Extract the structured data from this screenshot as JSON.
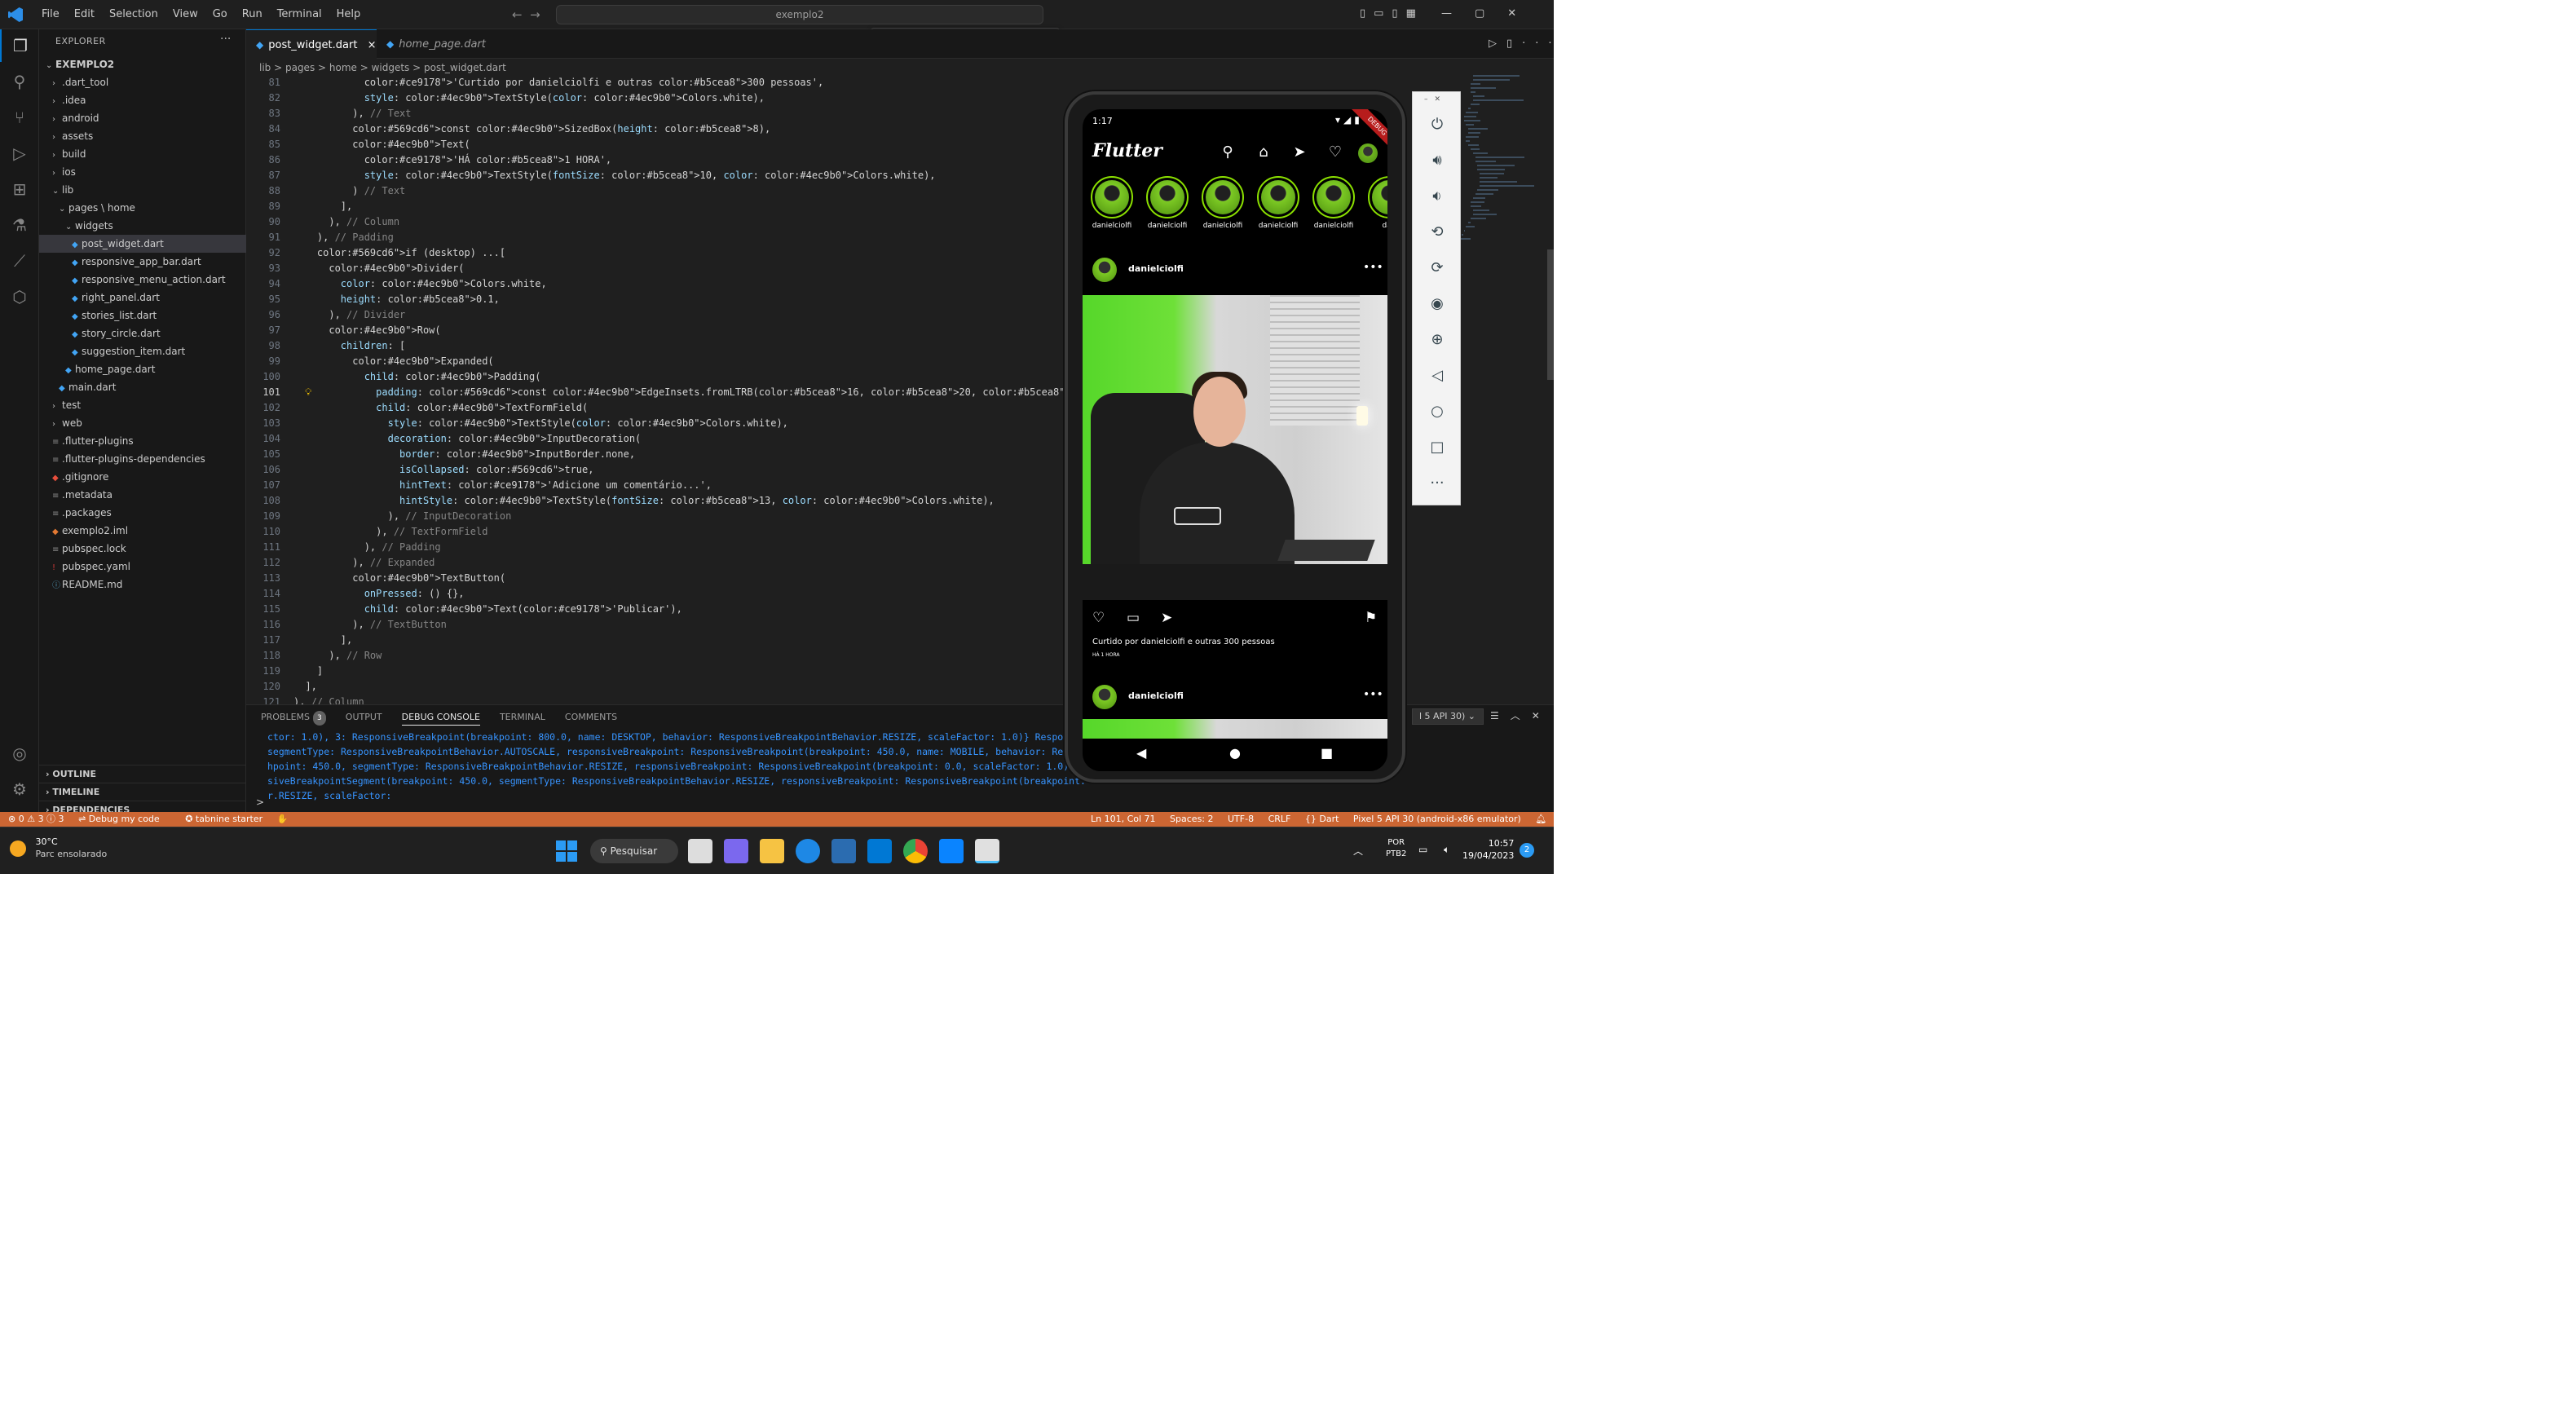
{
  "window": {
    "search": "exemplo2"
  },
  "menu": [
    "File",
    "Edit",
    "Selection",
    "View",
    "Go",
    "Run",
    "Terminal",
    "Help"
  ],
  "explorer": {
    "title": "EXPLORER",
    "root": "EXEMPLO2",
    "tree": [
      {
        "label": ".dart_tool",
        "indent": 1,
        "kind": "folder",
        "open": false
      },
      {
        "label": ".idea",
        "indent": 1,
        "kind": "folder",
        "open": false
      },
      {
        "label": "android",
        "indent": 1,
        "kind": "folder",
        "open": false
      },
      {
        "label": "assets",
        "indent": 1,
        "kind": "folder",
        "open": false
      },
      {
        "label": "build",
        "indent": 1,
        "kind": "folder",
        "open": false
      },
      {
        "label": "ios",
        "indent": 1,
        "kind": "folder",
        "open": false
      },
      {
        "label": "lib",
        "indent": 1,
        "kind": "folder",
        "open": true
      },
      {
        "label": "pages \\ home",
        "indent": 2,
        "kind": "folder",
        "open": true
      },
      {
        "label": "widgets",
        "indent": 3,
        "kind": "folder",
        "open": true
      },
      {
        "label": "post_widget.dart",
        "indent": 4,
        "kind": "dart",
        "selected": true
      },
      {
        "label": "responsive_app_bar.dart",
        "indent": 4,
        "kind": "dart"
      },
      {
        "label": "responsive_menu_action.dart",
        "indent": 4,
        "kind": "dart"
      },
      {
        "label": "right_panel.dart",
        "indent": 4,
        "kind": "dart"
      },
      {
        "label": "stories_list.dart",
        "indent": 4,
        "kind": "dart"
      },
      {
        "label": "story_circle.dart",
        "indent": 4,
        "kind": "dart"
      },
      {
        "label": "suggestion_item.dart",
        "indent": 4,
        "kind": "dart"
      },
      {
        "label": "home_page.dart",
        "indent": 3,
        "kind": "dart"
      },
      {
        "label": "main.dart",
        "indent": 2,
        "kind": "dart"
      },
      {
        "label": "test",
        "indent": 1,
        "kind": "folder",
        "open": false
      },
      {
        "label": "web",
        "indent": 1,
        "kind": "folder",
        "open": false
      },
      {
        "label": ".flutter-plugins",
        "indent": 1,
        "kind": "file"
      },
      {
        "label": ".flutter-plugins-dependencies",
        "indent": 1,
        "kind": "file"
      },
      {
        "label": ".gitignore",
        "indent": 1,
        "kind": "git"
      },
      {
        "label": ".metadata",
        "indent": 1,
        "kind": "file"
      },
      {
        "label": ".packages",
        "indent": 1,
        "kind": "file"
      },
      {
        "label": "exemplo2.iml",
        "indent": 1,
        "kind": "xml"
      },
      {
        "label": "pubspec.lock",
        "indent": 1,
        "kind": "file"
      },
      {
        "label": "pubspec.yaml",
        "indent": 1,
        "kind": "yaml"
      },
      {
        "label": "README.md",
        "indent": 1,
        "kind": "info"
      }
    ],
    "sections": [
      "OUTLINE",
      "TIMELINE",
      "DEPENDENCIES"
    ]
  },
  "tabs": [
    {
      "label": "post_widget.dart",
      "active": true,
      "close": "×"
    },
    {
      "label": "home_page.dart",
      "active": false
    }
  ],
  "breadcrumb": "lib  >  pages  >  home  >  widgets  >  post_widget.dart",
  "code": {
    "current_line": 101,
    "lines": [
      {
        "n": 81,
        "t": "            'Curtido por danielciolfi e outras 300 pessoas',"
      },
      {
        "n": 82,
        "t": "            style: TextStyle(color: Colors.white),"
      },
      {
        "n": 83,
        "t": "          ), // Text"
      },
      {
        "n": 84,
        "t": "          const SizedBox(height: 8),"
      },
      {
        "n": 85,
        "t": "          Text("
      },
      {
        "n": 86,
        "t": "            'HÁ 1 HORA',"
      },
      {
        "n": 87,
        "t": "            style: TextStyle(fontSize: 10, color: Colors.white),"
      },
      {
        "n": 88,
        "t": "          ) // Text"
      },
      {
        "n": 89,
        "t": "        ],"
      },
      {
        "n": 90,
        "t": "      ), // Column"
      },
      {
        "n": 91,
        "t": "    ), // Padding"
      },
      {
        "n": 92,
        "t": "    if (desktop) ...["
      },
      {
        "n": 93,
        "t": "      Divider("
      },
      {
        "n": 94,
        "t": "        color: Colors.white,"
      },
      {
        "n": 95,
        "t": "        height: 0.1,"
      },
      {
        "n": 96,
        "t": "      ), // Divider"
      },
      {
        "n": 97,
        "t": "      Row("
      },
      {
        "n": 98,
        "t": "        children: ["
      },
      {
        "n": 99,
        "t": "          Expanded("
      },
      {
        "n": 100,
        "t": "            child: Padding("
      },
      {
        "n": 101,
        "t": "              padding: const EdgeInsets.fromLTRB(16, 20, 0, 24),"
      },
      {
        "n": 102,
        "t": "              child: TextFormField("
      },
      {
        "n": 103,
        "t": "                style: TextStyle(color: Colors.white),"
      },
      {
        "n": 104,
        "t": "                decoration: InputDecoration("
      },
      {
        "n": 105,
        "t": "                  border: InputBorder.none,"
      },
      {
        "n": 106,
        "t": "                  isCollapsed: true,"
      },
      {
        "n": 107,
        "t": "                  hintText: 'Adicione um comentário...',"
      },
      {
        "n": 108,
        "t": "                  hintStyle: TextStyle(fontSize: 13, color: Colors.white),"
      },
      {
        "n": 109,
        "t": "                ), // InputDecoration"
      },
      {
        "n": 110,
        "t": "              ), // TextFormField"
      },
      {
        "n": 111,
        "t": "            ), // Padding"
      },
      {
        "n": 112,
        "t": "          ), // Expanded"
      },
      {
        "n": 113,
        "t": "          TextButton("
      },
      {
        "n": 114,
        "t": "            onPressed: () {},"
      },
      {
        "n": 115,
        "t": "            child: Text('Publicar'),"
      },
      {
        "n": 116,
        "t": "          ), // TextButton"
      },
      {
        "n": 117,
        "t": "        ],"
      },
      {
        "n": 118,
        "t": "      ), // Row"
      },
      {
        "n": 119,
        "t": "    ]"
      },
      {
        "n": 120,
        "t": "  ],"
      },
      {
        "n": 121,
        "t": "), // Column"
      }
    ]
  },
  "panel": {
    "tabs": [
      {
        "label": "PROBLEMS",
        "badge": "3"
      },
      {
        "label": "OUTPUT"
      },
      {
        "label": "DEBUG CONSOLE",
        "active": true
      },
      {
        "label": "TERMINAL"
      },
      {
        "label": "COMMENTS"
      }
    ],
    "device_select": "l 5 API 30)",
    "console": [
      "ctor: 1.0), 3: ResponsiveBreakpoint(breakpoint: 800.0, name: DESKTOP, behavior: ResponsiveBreakpointBehavior.RESIZE, scaleFactor: 1.0)} Respons",
      "segmentType: ResponsiveBreakpointBehavior.AUTOSCALE, responsiveBreakpoint: ResponsiveBreakpoint(breakpoint: 450.0, name: MOBILE, behavior: Resp",
      "hpoint: 450.0, segmentType: ResponsiveBreakpointBehavior.RESIZE, responsiveBreakpoint: ResponsiveBreakpoint(breakpoint: 0.0, scaleFactor: 1.0)}, Respon",
      "siveBreakpointSegment(breakpoint: 450.0, segmentType: ResponsiveBreakpointBehavior.RESIZE, responsiveBreakpoint: ResponsiveBreakpoint(breakpoint:",
      "r.RESIZE, scaleFactor:"
    ],
    "prompt": ">"
  },
  "statusbar": {
    "left": [
      "⊗ 0 ⚠ 3 ⓘ 3",
      "Debug my code",
      "tabnine starter"
    ],
    "right": [
      "Ln 101, Col 71",
      "Spaces: 2",
      "UTF-8",
      "CRLF",
      "{} Dart",
      "Pixel 5 API 30 (android-x86 emulator)"
    ]
  },
  "taskbar": {
    "weather_temp": "30°C",
    "weather_desc": "Parc ensolarado",
    "search": "Pesquisar",
    "lang_1": "POR",
    "lang_2": "PTB2",
    "time": "10:57",
    "date": "19/04/2023",
    "notif": "2"
  },
  "phone": {
    "status_time": "1:17",
    "debug_ribbon": "DEBUG",
    "app_title": "Flutter",
    "stories": [
      "danielciolfi",
      "danielciolfi",
      "danielciolfi",
      "danielciolfi",
      "danielciolfi",
      "dan"
    ],
    "post_user": "danielciolfi",
    "liked_text": "Curtido por danielciolfi e outras 300 pessoas",
    "time_text": "HÁ 1 HORA",
    "post2_user": "danielciolfi"
  },
  "colors": {
    "accent": "#0078d4",
    "status_bar": "#cc6633",
    "story_ring": "#8be000"
  }
}
